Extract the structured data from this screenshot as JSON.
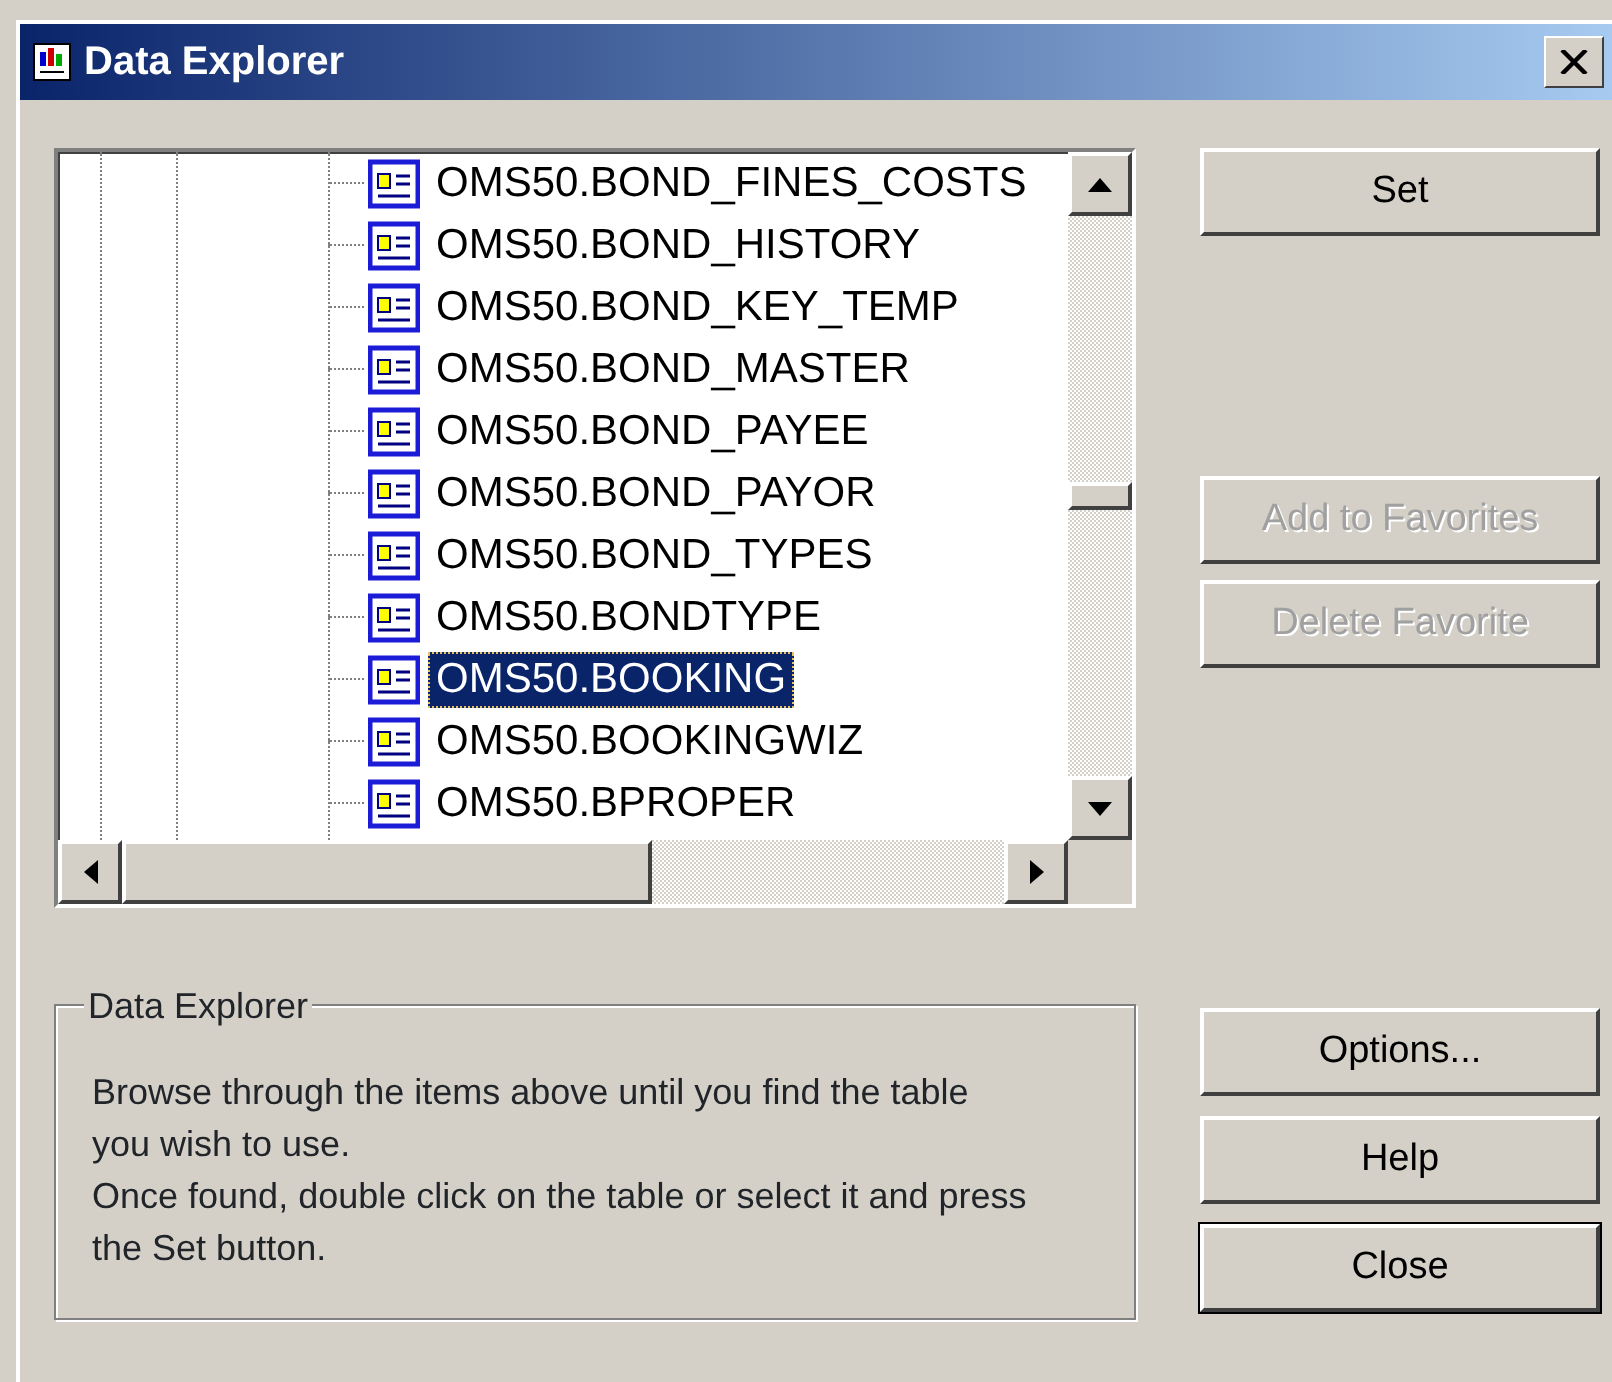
{
  "window": {
    "title": "Data Explorer"
  },
  "tree": {
    "items": [
      {
        "label": "OMS50.BOND_FINES_COSTS",
        "selected": false
      },
      {
        "label": "OMS50.BOND_HISTORY",
        "selected": false
      },
      {
        "label": "OMS50.BOND_KEY_TEMP",
        "selected": false
      },
      {
        "label": "OMS50.BOND_MASTER",
        "selected": false
      },
      {
        "label": "OMS50.BOND_PAYEE",
        "selected": false
      },
      {
        "label": "OMS50.BOND_PAYOR",
        "selected": false
      },
      {
        "label": "OMS50.BOND_TYPES",
        "selected": false
      },
      {
        "label": "OMS50.BONDTYPE",
        "selected": false
      },
      {
        "label": "OMS50.BOOKING",
        "selected": true
      },
      {
        "label": "OMS50.BOOKINGWIZ",
        "selected": false
      },
      {
        "label": "OMS50.BPROPER",
        "selected": false
      }
    ]
  },
  "top_buttons": [
    {
      "label": "Set",
      "disabled": false,
      "default": false
    }
  ],
  "favorite_buttons": [
    {
      "label": "Add to Favorites",
      "disabled": true,
      "default": false
    },
    {
      "label": "Delete Favorite",
      "disabled": true,
      "default": false
    }
  ],
  "info": {
    "title": "Data Explorer",
    "paragraphs": [
      "Browse through the items above until you find the table you wish to use.",
      "Once found, double click on the table or select it and press the Set button."
    ]
  },
  "bottom_buttons": [
    {
      "label": "Options...",
      "disabled": false,
      "default": false
    },
    {
      "label": "Help",
      "disabled": false,
      "default": false
    },
    {
      "label": "Close",
      "disabled": false,
      "default": true
    }
  ]
}
